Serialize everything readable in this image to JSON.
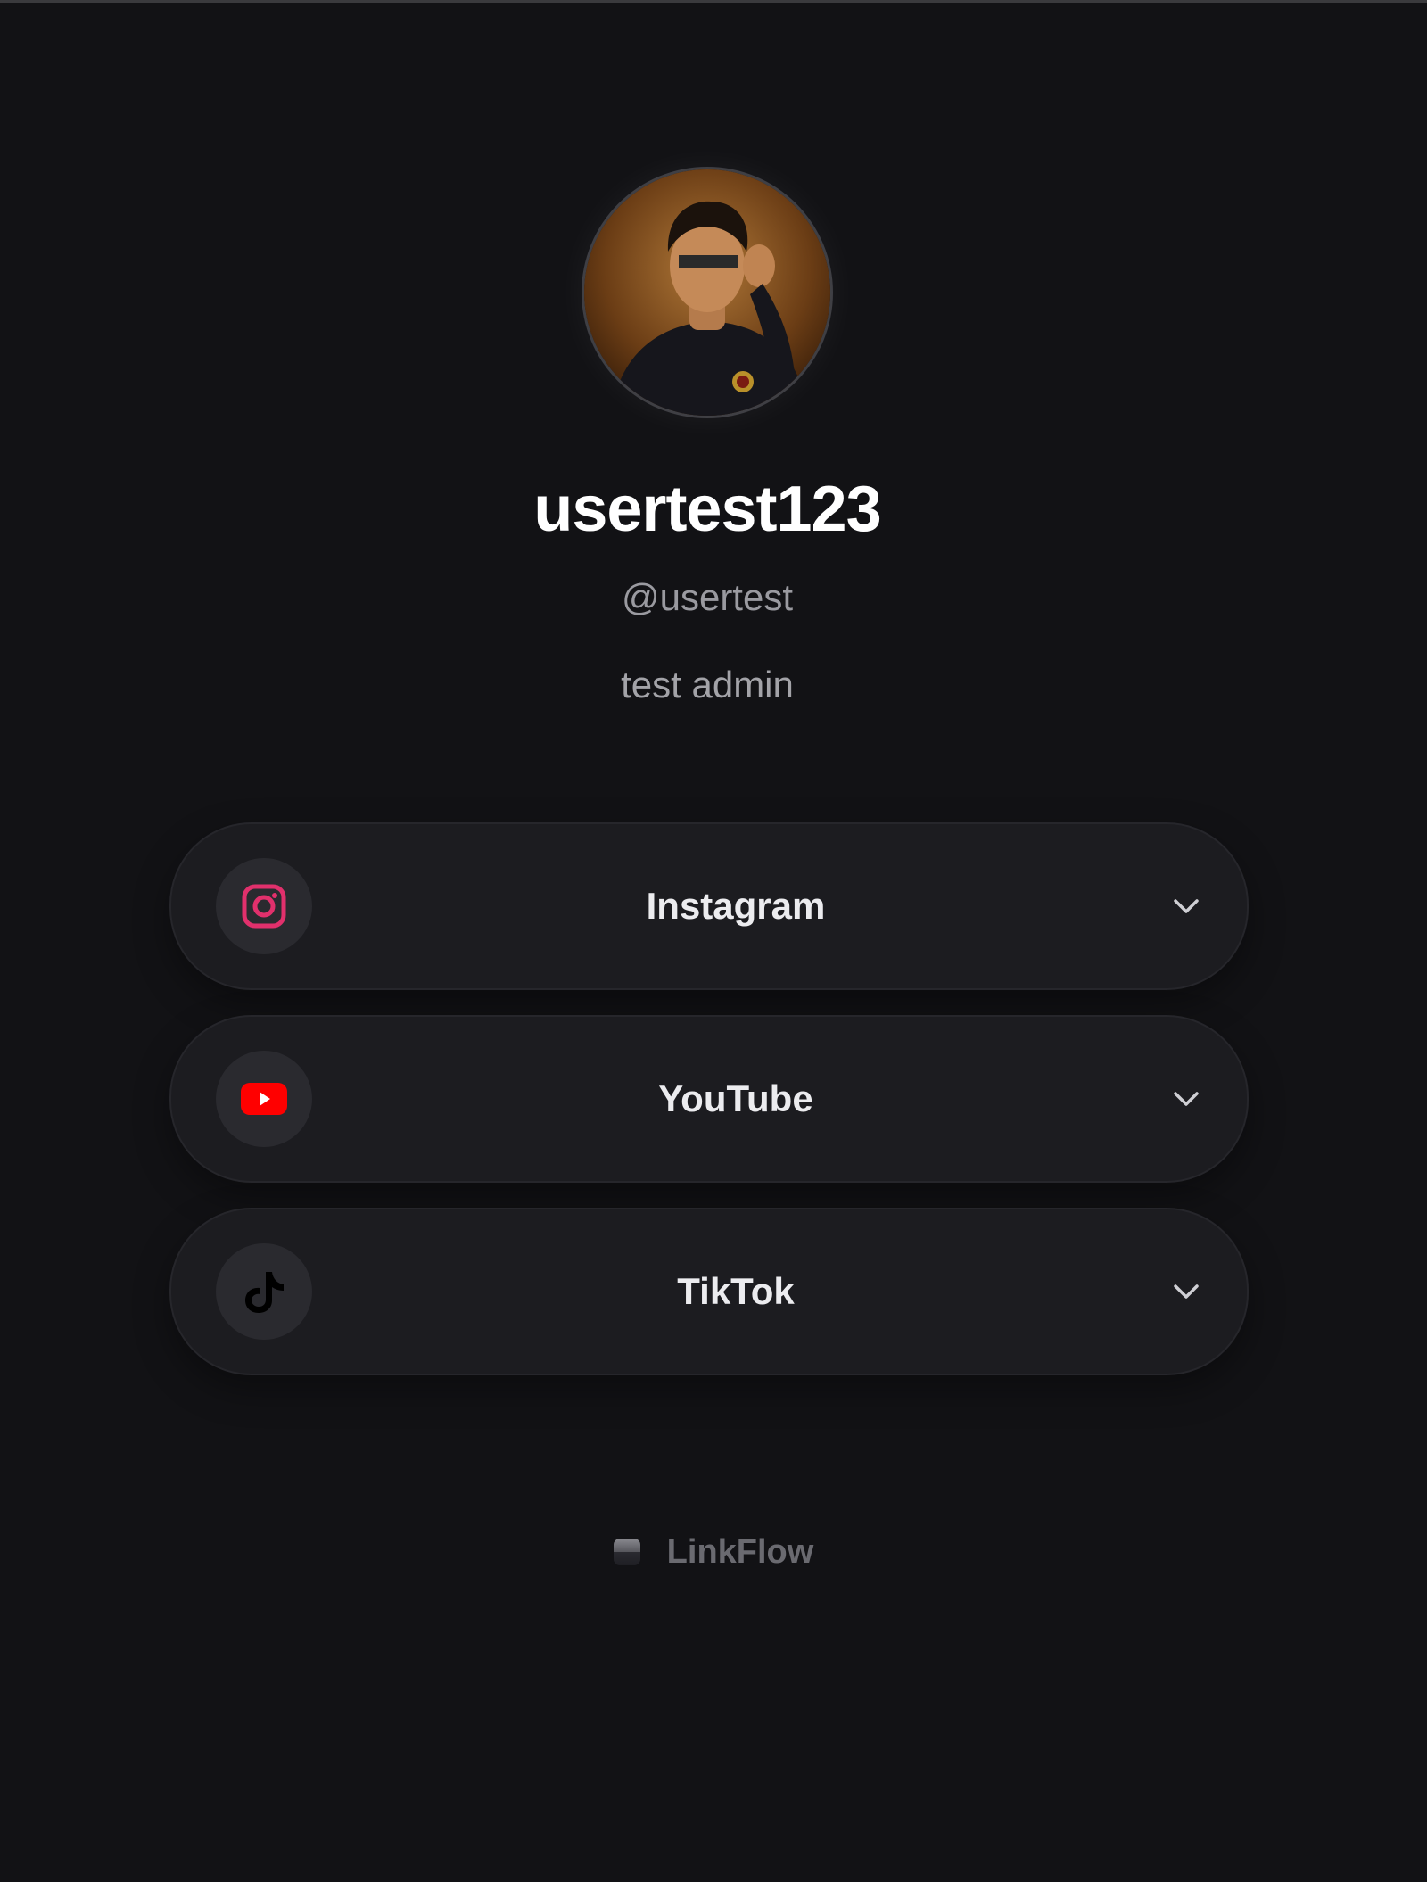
{
  "profile": {
    "display_name": "usertest123",
    "handle": "@usertest",
    "bio": "test admin"
  },
  "links": [
    {
      "label": "Instagram",
      "icon": "instagram-icon",
      "color": "#e1306c"
    },
    {
      "label": "YouTube",
      "icon": "youtube-icon",
      "color": "#ff0000"
    },
    {
      "label": "TikTok",
      "icon": "tiktok-icon",
      "color": "#000000"
    }
  ],
  "footer": {
    "brand": "LinkFlow"
  }
}
